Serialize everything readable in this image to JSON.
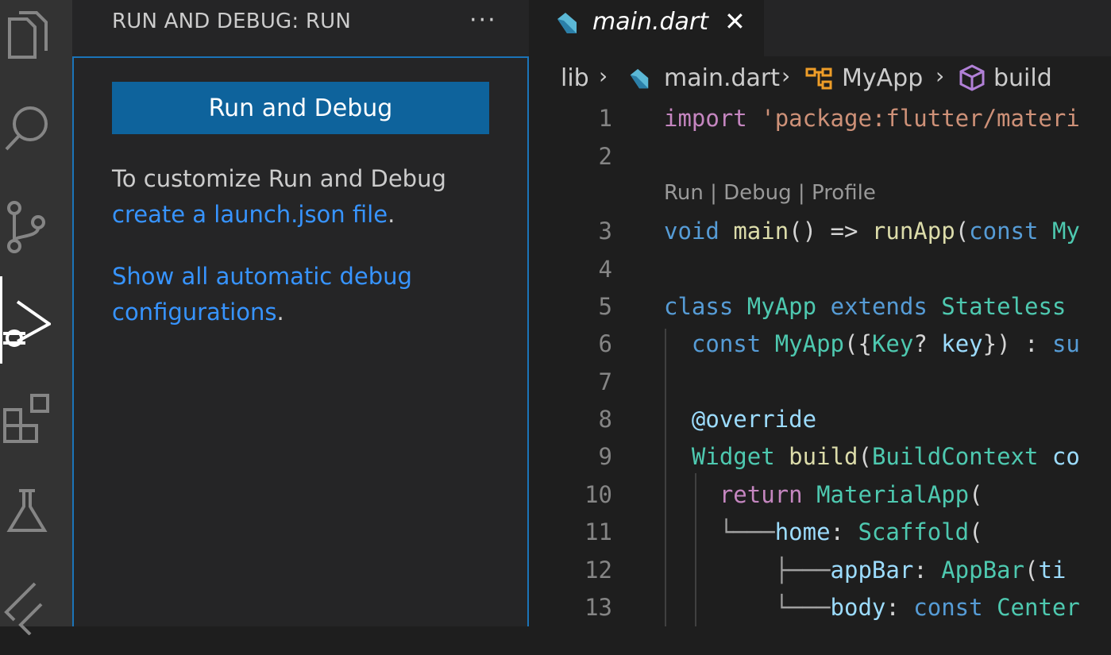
{
  "sidebar": {
    "title": "RUN AND DEBUG: RUN",
    "more": "···",
    "run_button": "Run and Debug",
    "customize_text": "To customize Run and Debug",
    "launch_link": "create a launch.json file",
    "period1": ".",
    "auto_link_1": "Show all automatic debug",
    "auto_link_2": "configurations",
    "period2": "."
  },
  "editor": {
    "tab_label": "main.dart",
    "tab_close": "✕",
    "breadcrumb": {
      "lib": "lib",
      "file": "main.dart",
      "class": "MyApp",
      "method": "build",
      "sep": "›"
    },
    "codelens": {
      "run": "Run",
      "debug": "Debug",
      "profile": "Profile",
      "sep": " | "
    },
    "lines": {
      "n1": "1",
      "n2": "2",
      "n3": "3",
      "n4": "4",
      "n5": "5",
      "n6": "6",
      "n7": "7",
      "n8": "8",
      "n9": "9",
      "n10": "10",
      "n11": "11",
      "n12": "12",
      "n13": "13",
      "l1_kw": "import",
      "l1_str": "'package:flutter/materi",
      "l3_void": "void",
      "l3_main": "main",
      "l3_p1": "() => ",
      "l3_runapp": "runApp",
      "l3_p2": "(",
      "l3_const": "const",
      "l3_my": "My",
      "l5_class": "class",
      "l5_name": "MyApp",
      "l5_extends": "extends",
      "l5_super": "Stateless",
      "l6_const": "const",
      "l6_name": "MyApp",
      "l6_p1": "({",
      "l6_key": "Key",
      "l6_q": "? ",
      "l6_kv": "key",
      "l6_p2": "}) : ",
      "l6_su": "su",
      "l8_anno": "@override",
      "l9_widget": "Widget",
      "l9_build": "build",
      "l9_p": "(",
      "l9_ctx": "BuildContext",
      "l9_co": "co",
      "l10_return": "return",
      "l10_app": "MaterialApp",
      "l10_p": "(",
      "l11_tree": "└───",
      "l11_home": "home",
      "l11_c": ": ",
      "l11_sc": "Scaffold",
      "l11_p": "(",
      "l12_tree": "├───",
      "l12_appbar": "appBar",
      "l12_c": ": ",
      "l12_ab": "AppBar",
      "l12_p": "(",
      "l12_ti": "ti",
      "l13_tree": "└───",
      "l13_body": "body",
      "l13_c": ": ",
      "l13_const": "const",
      "l13_center": "Center"
    }
  },
  "activity_icons": [
    "explorer-icon",
    "search-icon",
    "source-control-icon",
    "run-debug-icon",
    "extensions-icon",
    "testing-icon",
    "flutter-icon"
  ],
  "colors": {
    "accent": "#0e639c",
    "link": "#3794ff",
    "focus_border": "#1b74b8"
  }
}
